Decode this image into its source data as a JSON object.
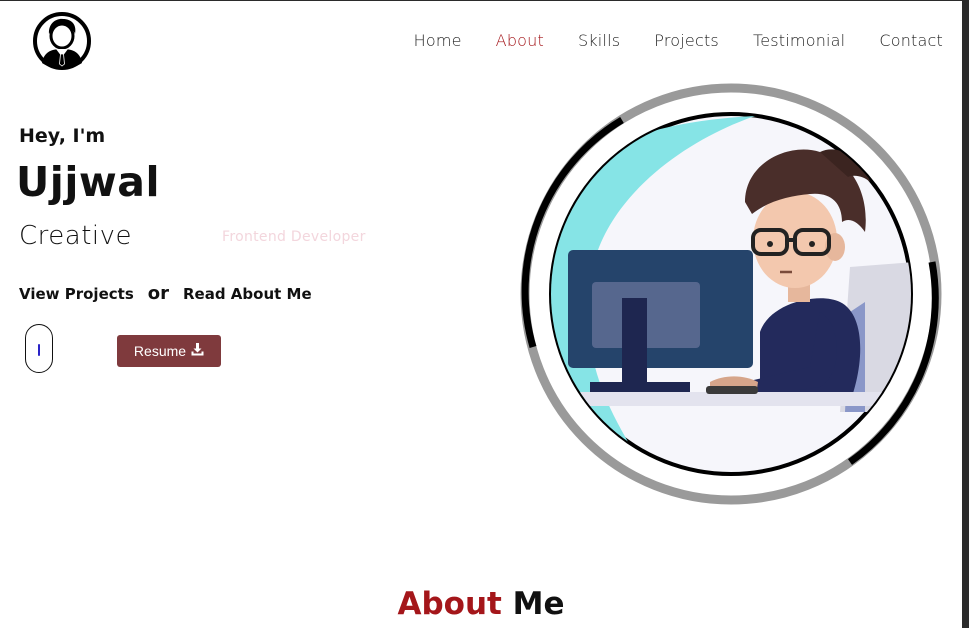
{
  "nav": {
    "items": [
      {
        "label": "Home",
        "active": false
      },
      {
        "label": "About",
        "active": true
      },
      {
        "label": "Skills",
        "active": false
      },
      {
        "label": "Projects",
        "active": false
      },
      {
        "label": "Testimonial",
        "active": false
      },
      {
        "label": "Contact",
        "active": false
      }
    ],
    "active_color": "#a4161a"
  },
  "hero": {
    "greeting": "Hey, I'm",
    "name": "Ujjwal",
    "role_prefix": "Creative",
    "typed_role": "Frontend Developer",
    "view_projects": "View Projects",
    "or": "or",
    "read_about": "Read About Me",
    "resume_label": "Resume",
    "resume_icon": "download-icon",
    "resume_color": "#7f3a3d"
  },
  "about": {
    "heading_accent": "About",
    "heading_rest": "Me",
    "accent_color": "#a4161a"
  },
  "icons": {
    "logo": "user-avatar-icon",
    "scroll": "scroll-mouse-icon",
    "illustration": "developer-at-computer-illustration"
  }
}
